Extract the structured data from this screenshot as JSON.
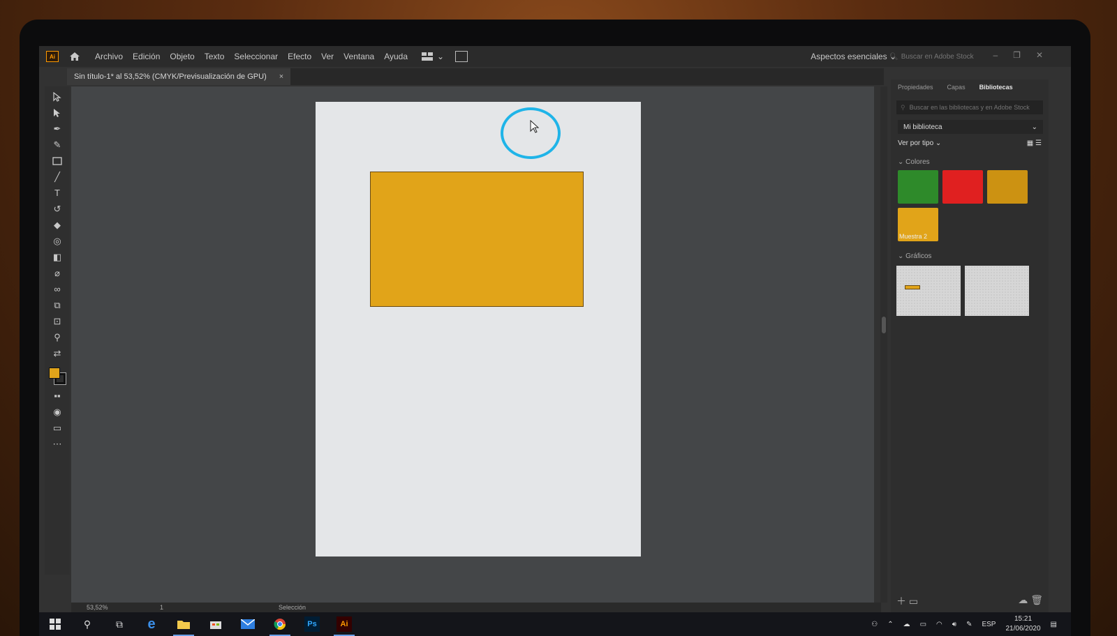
{
  "menu": {
    "items": [
      "Archivo",
      "Edición",
      "Objeto",
      "Texto",
      "Seleccionar",
      "Efecto",
      "Ver",
      "Ventana",
      "Ayuda"
    ],
    "app_logo": "Ai",
    "workspace": "Aspectos esenciales",
    "stock_search_placeholder": "Buscar en Adobe Stock"
  },
  "document": {
    "tab_title": "Sin título-1* al 53,52% (CMYK/Previsualización de GPU)",
    "close_glyph": "×"
  },
  "colors": {
    "accent": "#e1a419",
    "highlight_circle": "#1fb4e8"
  },
  "status": {
    "zoom": "53,52%",
    "page": "1",
    "mode": "Selección"
  },
  "panel": {
    "tabs": [
      "Propiedades",
      "Capas",
      "Bibliotecas"
    ],
    "active_tab": "Bibliotecas",
    "search_placeholder": "Buscar en las bibliotecas y en Adobe Stock",
    "library": "Mi biblioteca",
    "view_by": "Ver por tipo",
    "colors_heading": "Colores",
    "graphics_heading": "Gráficos",
    "swatches": [
      {
        "color": "#2e8a2a",
        "label": ""
      },
      {
        "color": "#e02020",
        "label": ""
      },
      {
        "color": "#cc9212",
        "label": ""
      },
      {
        "color": "#e1a419",
        "label": "Muestra 2"
      }
    ]
  },
  "taskbar": {
    "ps_label": "Ps",
    "ai_label": "Ai",
    "language": "ESP",
    "time": "15:21",
    "date": "21/06/2020"
  }
}
